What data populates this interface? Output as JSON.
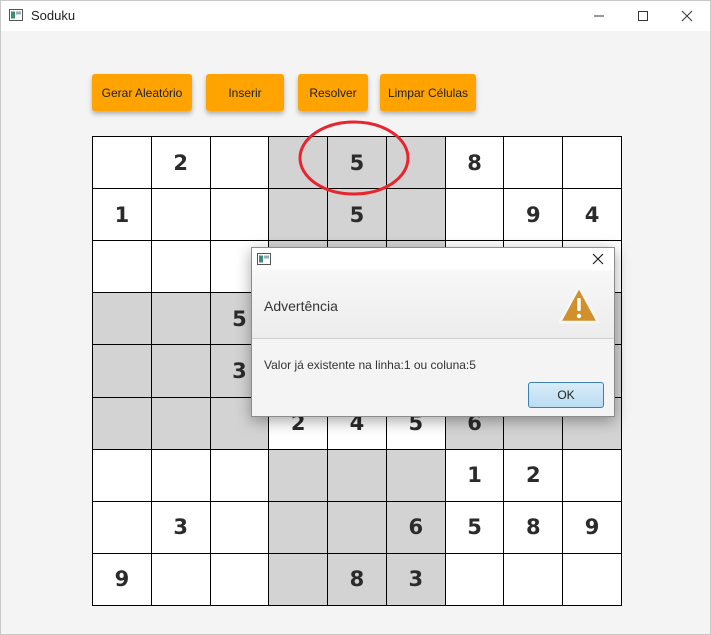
{
  "window": {
    "title": "Soduku"
  },
  "toolbar": {
    "generate_label": "Gerar Aleatório",
    "insert_label": "Inserir",
    "solve_label": "Resolver",
    "clear_label": "Limpar Células",
    "accent_color": "#ffa300"
  },
  "board": {
    "rows": [
      [
        "",
        "2",
        "",
        "",
        "5",
        "",
        "8",
        "",
        ""
      ],
      [
        "1",
        "",
        "",
        "",
        "5",
        "",
        "",
        "9",
        "4"
      ],
      [
        "",
        "",
        "",
        "",
        "",
        "",
        "",
        "",
        ""
      ],
      [
        "",
        "",
        "5",
        "",
        "",
        "",
        "",
        "",
        ""
      ],
      [
        "",
        "",
        "3",
        "",
        "",
        "",
        "",
        "",
        ""
      ],
      [
        "",
        "",
        "",
        "2",
        "4",
        "5",
        "6",
        "",
        ""
      ],
      [
        "",
        "",
        "",
        "",
        "",
        "",
        "1",
        "2",
        ""
      ],
      [
        "",
        "3",
        "",
        "",
        "",
        "6",
        "5",
        "8",
        "9"
      ],
      [
        "9",
        "",
        "",
        "",
        "8",
        "3",
        "",
        "",
        ""
      ]
    ],
    "shade_color": "#d3d3d3",
    "highlight_color": "#e8242c"
  },
  "dialog": {
    "header": "Advertência",
    "message": "Valor já existente na linha:1 ou coluna:5",
    "ok_label": "OK",
    "icon": "warning-icon"
  }
}
